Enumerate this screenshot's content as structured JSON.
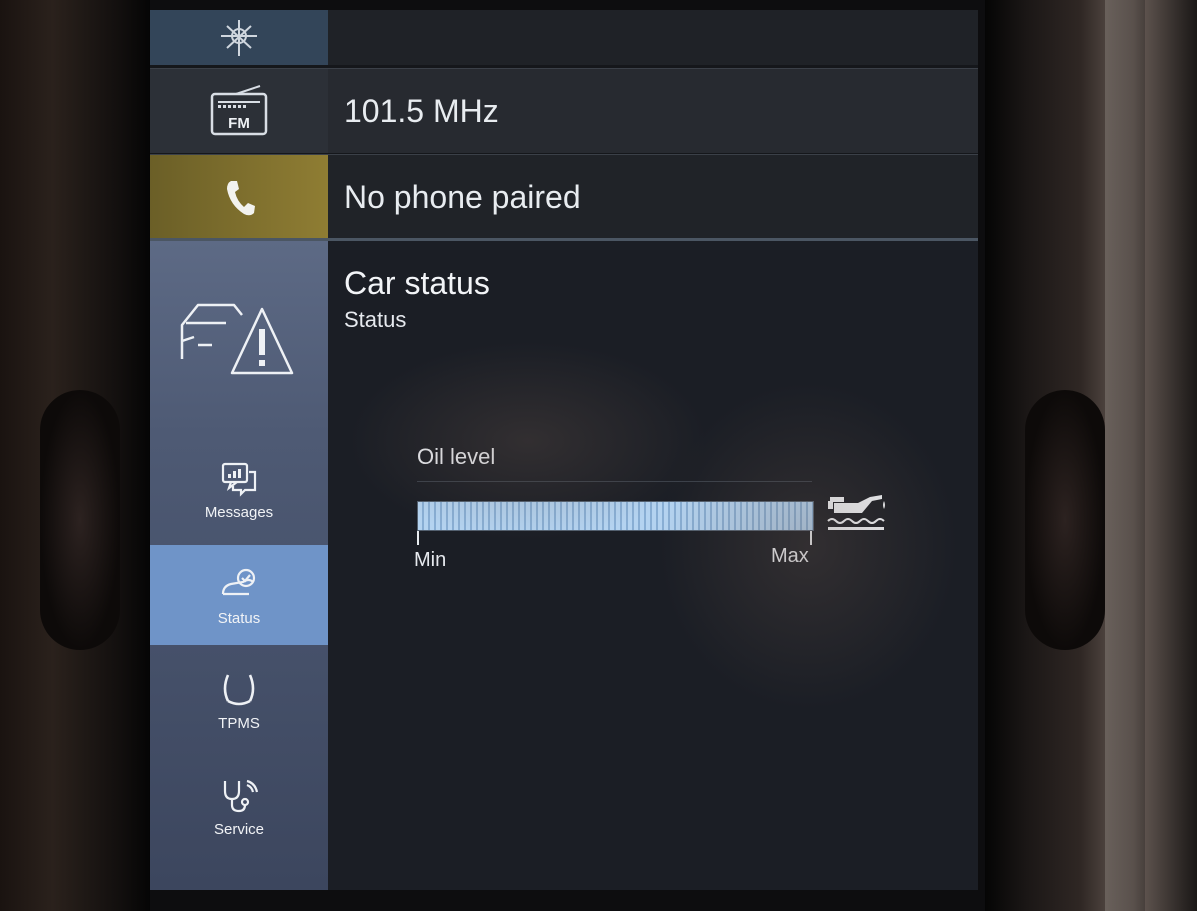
{
  "rows": {
    "navigation": {
      "icon": "navigation-compass-icon"
    },
    "radio": {
      "icon": "fm-radio-icon",
      "icon_text": "FM",
      "station": "101.5 MHz"
    },
    "phone": {
      "icon": "phone-icon",
      "status": "No phone paired"
    }
  },
  "car_status": {
    "icon": "car-warning-icon",
    "title": "Car status",
    "subtitle": "Status",
    "oil": {
      "label": "Oil level",
      "min_label": "Min",
      "max_label": "Max",
      "level_fraction": 1.0,
      "icon": "oil-can-icon"
    }
  },
  "sidebar": {
    "items": [
      {
        "label": "Messages",
        "icon": "messages-icon",
        "active": false
      },
      {
        "label": "Status",
        "icon": "car-status-icon",
        "active": true
      },
      {
        "label": "TPMS",
        "icon": "tire-pressure-icon",
        "active": false
      },
      {
        "label": "Service",
        "icon": "service-stethoscope-icon",
        "active": false
      }
    ]
  },
  "colors": {
    "active_tab": "#6f94c8",
    "sidebar": "#4e5a74",
    "phone_accent": "#8f7d33",
    "oil_fill": "#b4d3f0"
  }
}
